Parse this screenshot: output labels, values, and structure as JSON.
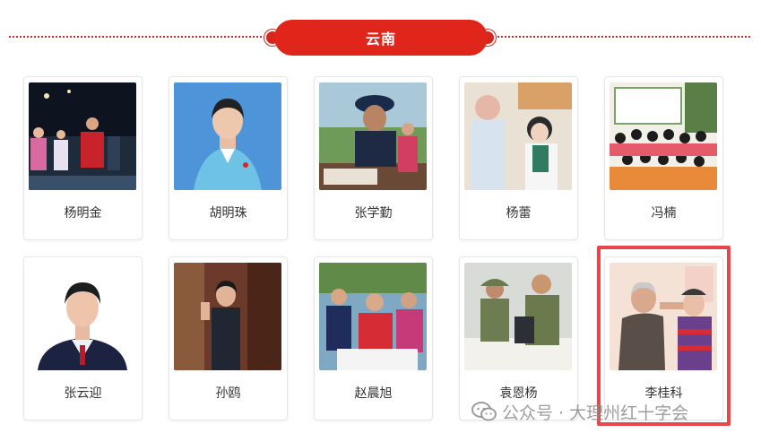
{
  "section": {
    "title": "云南"
  },
  "people": [
    {
      "name": "杨明金"
    },
    {
      "name": "胡明珠"
    },
    {
      "name": "张学勤"
    },
    {
      "name": "杨蕾"
    },
    {
      "name": "冯楠"
    },
    {
      "name": "张云迎"
    },
    {
      "name": "孙鸥"
    },
    {
      "name": "赵晨旭"
    },
    {
      "name": "袁恩杨"
    },
    {
      "name": "李桂科"
    }
  ],
  "watermark": {
    "text": "公众号 · 大理州红十字会",
    "icon": "wechat-icon"
  },
  "colors": {
    "accent": "#e0261b",
    "highlight": "#e8474a"
  }
}
